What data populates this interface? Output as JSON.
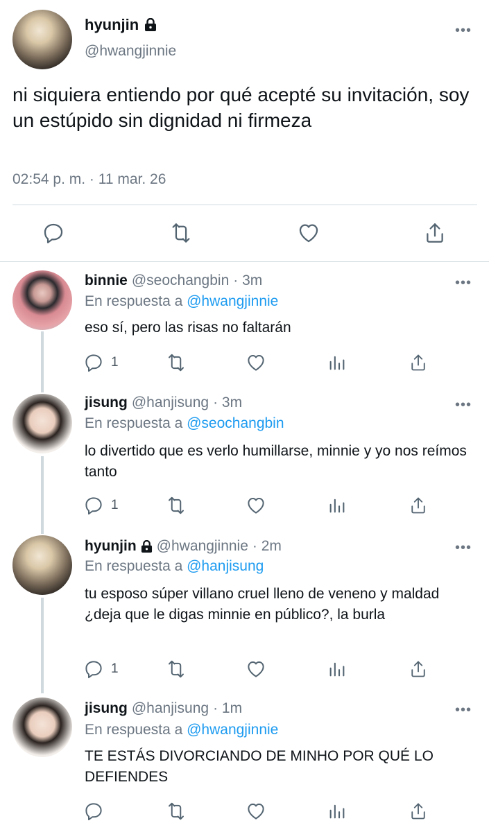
{
  "main_tweet": {
    "name": "hyunjin",
    "handle": "@hwangjinnie",
    "text": "ni siquiera entiendo por qué acepté su invitación, soy un estúpido sin dignidad ni firmeza",
    "timestamp": "02:54 p. m. · 11 mar. 26",
    "actions": [
      "reply-icon",
      "retweet-icon",
      "like-icon",
      "share-icon"
    ]
  },
  "replies": [
    {
      "name": "binnie",
      "handle": "@seochangbin",
      "time": "· 3m",
      "in_reply_prefix": "En respuesta a",
      "in_reply_to": "@hwangjinnie",
      "text": "eso sí, pero las risas no faltarán",
      "reply_count": "1"
    },
    {
      "name": "jisung",
      "handle": "@hanjisung",
      "time": "· 3m",
      "in_reply_prefix": "En respuesta a",
      "in_reply_to": "@seochangbin",
      "text": "lo divertido que es verlo humillarse, minnie y yo nos reímos tanto",
      "reply_count": "1"
    },
    {
      "name": "hyunjin",
      "handle": "@hwangjinnie",
      "time": "· 2m",
      "in_reply_prefix": "En respuesta a",
      "in_reply_to": "@hanjisung",
      "text": "tu esposo súper villano cruel lleno de veneno y maldad ¿deja que le digas minnie en público?, la burla",
      "reply_count": "1"
    },
    {
      "name": "jisung",
      "handle": "@hanjisung",
      "time": "· 1m",
      "in_reply_prefix": "En respuesta a",
      "in_reply_to": "@hwangjinnie",
      "text": "TE ESTÁS DIVORCIANDO DE MINHO POR QUÉ LO DEFIENDES",
      "reply_count": ""
    }
  ],
  "icons": {
    "more": "more-icon",
    "lock": "lock-icon",
    "views": "analytics-icon"
  },
  "colors": {
    "mention": "#1d9bf0",
    "secondary_text": "#6b7682",
    "divider": "#cfd9de"
  }
}
